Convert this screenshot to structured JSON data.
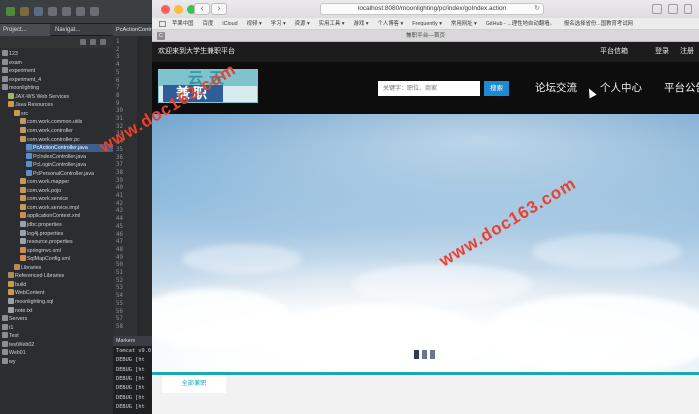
{
  "ide": {
    "tabs": [
      "Project...",
      "Navigat..."
    ],
    "editor_tab": "PcActionController.java",
    "line_numbers": [
      "1",
      "2",
      "3",
      "4",
      "5",
      "6",
      "7",
      "8",
      "9",
      "30",
      "31",
      "32",
      "33",
      "34",
      "35",
      "36",
      "37",
      "38",
      "39",
      "40",
      "41",
      "42",
      "43",
      "44",
      "45",
      "46",
      "47",
      "48",
      "49",
      "50",
      "51",
      "52",
      "53",
      "54",
      "55",
      "56",
      "57",
      "58"
    ],
    "tree": [
      {
        "label": "123",
        "indent": 0,
        "color": "#8a8f96"
      },
      {
        "label": "exam",
        "indent": 0,
        "color": "#8a8f96"
      },
      {
        "label": "experiment",
        "indent": 0,
        "color": "#8a8f96"
      },
      {
        "label": "experiment_4",
        "indent": 0,
        "color": "#8a8f96"
      },
      {
        "label": "moonlighting",
        "indent": 0,
        "color": "#8a8f96"
      },
      {
        "label": "JAX-WS Web Services",
        "indent": 1,
        "color": "#a4b36a"
      },
      {
        "label": "Java Resources",
        "indent": 1,
        "color": "#c99a4a"
      },
      {
        "label": "src",
        "indent": 2,
        "color": "#c99a4a"
      },
      {
        "label": "com.work.common.utils",
        "indent": 3,
        "color": "#c49a5a"
      },
      {
        "label": "com.work.controller",
        "indent": 3,
        "color": "#c49a5a"
      },
      {
        "label": "com.work.controller.pc",
        "indent": 3,
        "color": "#c49a5a"
      },
      {
        "label": "PcActionController.java",
        "indent": 4,
        "color": "#5b8fc9",
        "selected": true
      },
      {
        "label": "PcIndexController.java",
        "indent": 4,
        "color": "#5b8fc9"
      },
      {
        "label": "PcLoginController.java",
        "indent": 4,
        "color": "#5b8fc9"
      },
      {
        "label": "PcPersonalController.java",
        "indent": 4,
        "color": "#5b8fc9"
      },
      {
        "label": "com.work.mapper",
        "indent": 3,
        "color": "#c49a5a"
      },
      {
        "label": "com.work.pojo",
        "indent": 3,
        "color": "#c49a5a"
      },
      {
        "label": "com.work.service",
        "indent": 3,
        "color": "#c49a5a"
      },
      {
        "label": "com.work.service.impl",
        "indent": 3,
        "color": "#c49a5a"
      },
      {
        "label": "applicationContext.xml",
        "indent": 3,
        "color": "#d08c52"
      },
      {
        "label": "jdbc.properties",
        "indent": 3,
        "color": "#9aa2ab"
      },
      {
        "label": "log4j.properties",
        "indent": 3,
        "color": "#9aa2ab"
      },
      {
        "label": "resource.properties",
        "indent": 3,
        "color": "#9aa2ab"
      },
      {
        "label": "springmvc.xml",
        "indent": 3,
        "color": "#d08c52"
      },
      {
        "label": "SqlMapConfig.xml",
        "indent": 3,
        "color": "#d08c52"
      },
      {
        "label": "Libraries",
        "indent": 2,
        "color": "#b48a5a"
      },
      {
        "label": "Referenced Libraries",
        "indent": 1,
        "color": "#b48a5a"
      },
      {
        "label": "build",
        "indent": 1,
        "color": "#c99a4a"
      },
      {
        "label": "WebContent",
        "indent": 1,
        "color": "#c99a4a"
      },
      {
        "label": "moonlighting.sql",
        "indent": 1,
        "color": "#9aa2ab"
      },
      {
        "label": "note.txt",
        "indent": 1,
        "color": "#9aa2ab"
      },
      {
        "label": "Servers",
        "indent": 0,
        "color": "#8a8f96"
      },
      {
        "label": "t1",
        "indent": 0,
        "color": "#8a8f96"
      },
      {
        "label": "Test",
        "indent": 0,
        "color": "#8a8f96"
      },
      {
        "label": "testWeb02",
        "indent": 0,
        "color": "#8a8f96"
      },
      {
        "label": "Web01",
        "indent": 0,
        "color": "#8a8f96"
      },
      {
        "label": "wy",
        "indent": 0,
        "color": "#8a8f96"
      }
    ],
    "console_tab": "Markers",
    "console_lines": [
      "Tomcat v9.0",
      "DEBUG [ht",
      "DEBUG [ht",
      "DEBUG [ht",
      "DEBUG [ht",
      "DEBUG [ht",
      "DEBUG [ht"
    ]
  },
  "browser": {
    "url": "localhost:8080/moonlighting/pc/index/goIndex.action",
    "tab_title": "兼职平台—首页",
    "tab_ext": "C",
    "back_icon": "‹",
    "forward_icon": "›",
    "reload_icon": "↻",
    "traffic_colors": [
      "#fc605b",
      "#fdbc40",
      "#34c84a"
    ],
    "bookmarks": [
      "苹果中国",
      "百度",
      "iCloud",
      "视频 ▾",
      "学习 ▾",
      "资源 ▾",
      "实用工具 ▾",
      "游戏 ▾",
      "个人博客 ▾",
      "Frequently ▾",
      "常用网址 ▾",
      "GitHub - ...理性地自动翻墙。",
      "报名选择省份...国教育考试网"
    ]
  },
  "site": {
    "welcome": "欢迎来到大学生兼职平台",
    "top_links": [
      "平台信箱",
      "登录",
      "注册"
    ],
    "logo_top": "云天",
    "logo_bottom": "兼职",
    "search_placeholder": "关键字：职位、商家",
    "search_button": "搜索",
    "menu": [
      "论坛交流",
      "个人中心",
      "平台公告"
    ],
    "banner_dots": 3,
    "category_tab": "全部兼职",
    "accent": "#1aa8b8"
  },
  "watermark": "www.doc163.com"
}
